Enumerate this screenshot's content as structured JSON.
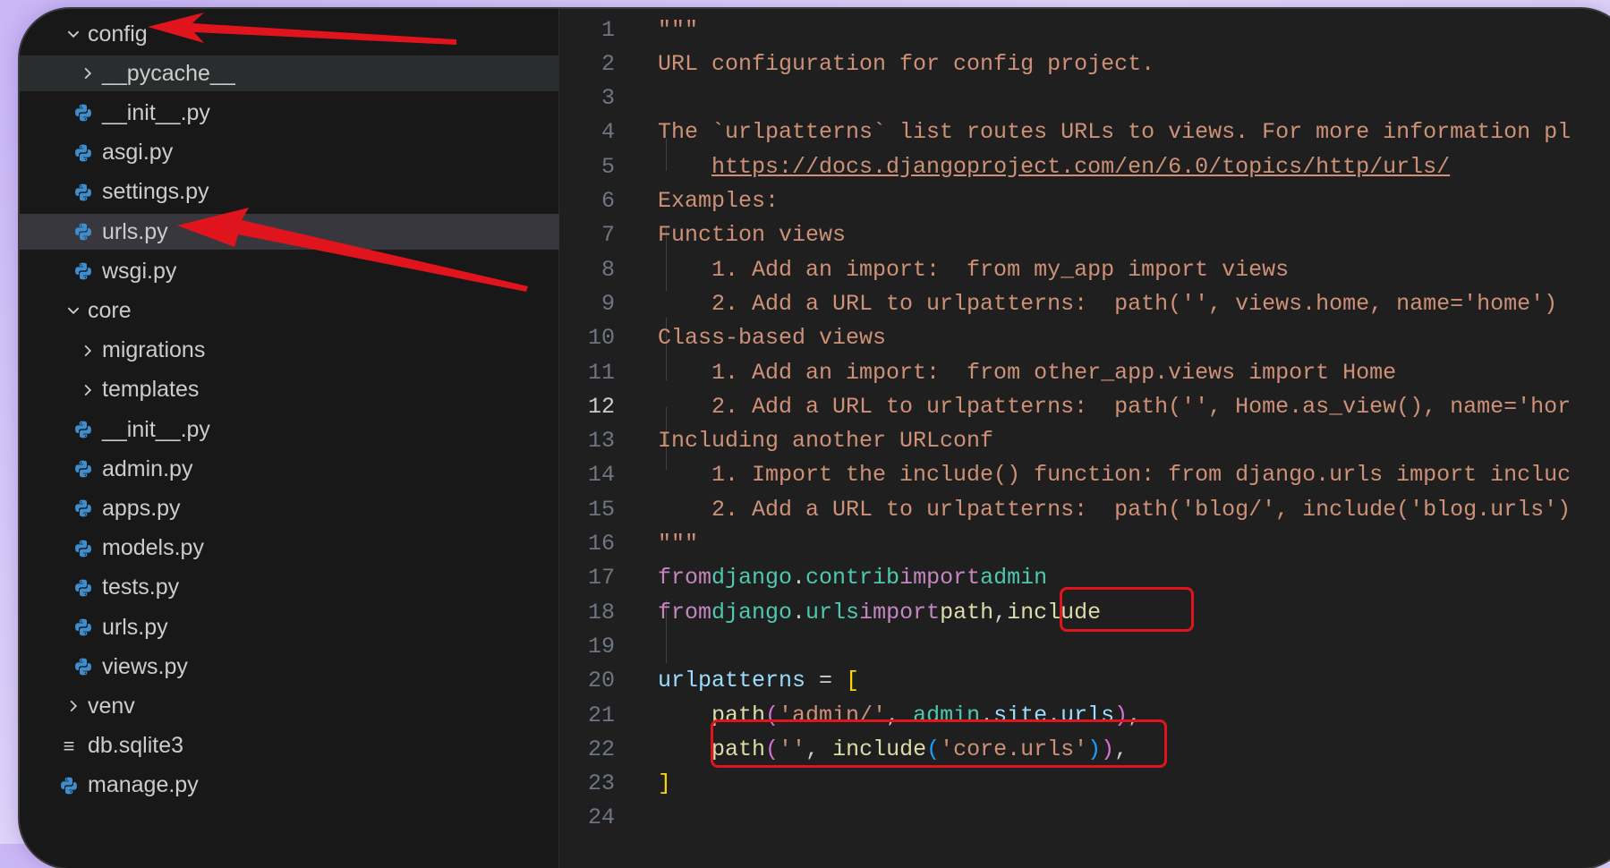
{
  "explorer": {
    "items": [
      {
        "label": "config",
        "kind": "folder-open",
        "indent": 0,
        "icon": "chevron-down-icon"
      },
      {
        "label": "__pycache__",
        "kind": "folder-closed",
        "indent": 1,
        "icon": "chevron-right-icon"
      },
      {
        "label": "__init__.py",
        "kind": "python",
        "indent": 1,
        "icon": "python-file-icon"
      },
      {
        "label": "asgi.py",
        "kind": "python",
        "indent": 1,
        "icon": "python-file-icon"
      },
      {
        "label": "settings.py",
        "kind": "python",
        "indent": 1,
        "icon": "python-file-icon"
      },
      {
        "label": "urls.py",
        "kind": "python",
        "indent": 1,
        "icon": "python-file-icon"
      },
      {
        "label": "wsgi.py",
        "kind": "python",
        "indent": 1,
        "icon": "python-file-icon"
      },
      {
        "label": "core",
        "kind": "folder-open",
        "indent": 0,
        "icon": "chevron-down-icon"
      },
      {
        "label": "migrations",
        "kind": "folder-closed",
        "indent": 1,
        "icon": "chevron-right-icon"
      },
      {
        "label": "templates",
        "kind": "folder-closed",
        "indent": 1,
        "icon": "chevron-right-icon"
      },
      {
        "label": "__init__.py",
        "kind": "python",
        "indent": 1,
        "icon": "python-file-icon"
      },
      {
        "label": "admin.py",
        "kind": "python",
        "indent": 1,
        "icon": "python-file-icon"
      },
      {
        "label": "apps.py",
        "kind": "python",
        "indent": 1,
        "icon": "python-file-icon"
      },
      {
        "label": "models.py",
        "kind": "python",
        "indent": 1,
        "icon": "python-file-icon"
      },
      {
        "label": "tests.py",
        "kind": "python",
        "indent": 1,
        "icon": "python-file-icon"
      },
      {
        "label": "urls.py",
        "kind": "python",
        "indent": 1,
        "icon": "python-file-icon"
      },
      {
        "label": "views.py",
        "kind": "python",
        "indent": 1,
        "icon": "python-file-icon"
      },
      {
        "label": "venv",
        "kind": "folder-closed",
        "indent": 0,
        "icon": "chevron-right-icon"
      },
      {
        "label": "db.sqlite3",
        "kind": "database",
        "indent": 0,
        "icon": "lines-file-icon"
      },
      {
        "label": "manage.py",
        "kind": "python",
        "indent": 0,
        "icon": "python-file-icon"
      }
    ],
    "selected_index": 5,
    "hovered_index": 1
  },
  "editor": {
    "active_line": 12,
    "lines": [
      {
        "n": "1",
        "text": "\"\"\""
      },
      {
        "n": "2",
        "text": "URL configuration for config project."
      },
      {
        "n": "3",
        "text": ""
      },
      {
        "n": "4",
        "text": "The `urlpatterns` list routes URLs to views. For more information pl"
      },
      {
        "n": "5",
        "text": "    https://docs.djangoproject.com/en/6.0/topics/http/urls/"
      },
      {
        "n": "6",
        "text": "Examples:"
      },
      {
        "n": "7",
        "text": "Function views"
      },
      {
        "n": "8",
        "text": "    1. Add an import:  from my_app import views"
      },
      {
        "n": "9",
        "text": "    2. Add a URL to urlpatterns:  path('', views.home, name='home')"
      },
      {
        "n": "10",
        "text": "Class-based views"
      },
      {
        "n": "11",
        "text": "    1. Add an import:  from other_app.views import Home"
      },
      {
        "n": "12",
        "text": "    2. Add a URL to urlpatterns:  path('', Home.as_view(), name='hor"
      },
      {
        "n": "13",
        "text": "Including another URLconf"
      },
      {
        "n": "14",
        "text": "    1. Import the include() function: from django.urls import incluc"
      },
      {
        "n": "15",
        "text": "    2. Add a URL to urlpatterns:  path('blog/', include('blog.urls')"
      },
      {
        "n": "16",
        "text": "\"\"\""
      },
      {
        "n": "17",
        "code": {
          "kw1": "from",
          "mod1": "django",
          "dot1": ".",
          "mod2": "contrib",
          "kw2": "import",
          "mod3": "admin"
        }
      },
      {
        "n": "18",
        "code": {
          "kw1": "from",
          "mod1": "django",
          "dot1": ".",
          "mod2": "urls",
          "kw2": "import",
          "fn1": "path",
          "sep": ",",
          "fn2": "include"
        }
      },
      {
        "n": "19",
        "text": ""
      },
      {
        "n": "20",
        "code": {
          "var": "urlpatterns",
          "op": " = ",
          "br": "["
        }
      },
      {
        "n": "21",
        "code": {
          "fn": "path",
          "p1": "(",
          "str": "'admin/'",
          "comma": ", ",
          "v1": "admin",
          "d1": ".",
          "v2": "site",
          "d2": ".",
          "v3": "urls",
          "p2": ")",
          "end": ","
        }
      },
      {
        "n": "22",
        "code": {
          "fn": "path",
          "p1": "(",
          "str": "''",
          "comma": ", ",
          "fn2": "include",
          "p2": "(",
          "str2": "'core.urls'",
          "p3": ")",
          "p4": ")",
          "end": ","
        }
      },
      {
        "n": "23",
        "code": {
          "br": "]"
        }
      },
      {
        "n": "24",
        "text": ""
      }
    ]
  },
  "colors": {
    "annotation_red": "#e0141d",
    "keyword": "#c586c0",
    "module": "#4ec9b0",
    "function": "#dcdcaa",
    "string": "#ce9178",
    "variable": "#9cdcfe",
    "python_icon_blue": "#3e8ecf"
  }
}
